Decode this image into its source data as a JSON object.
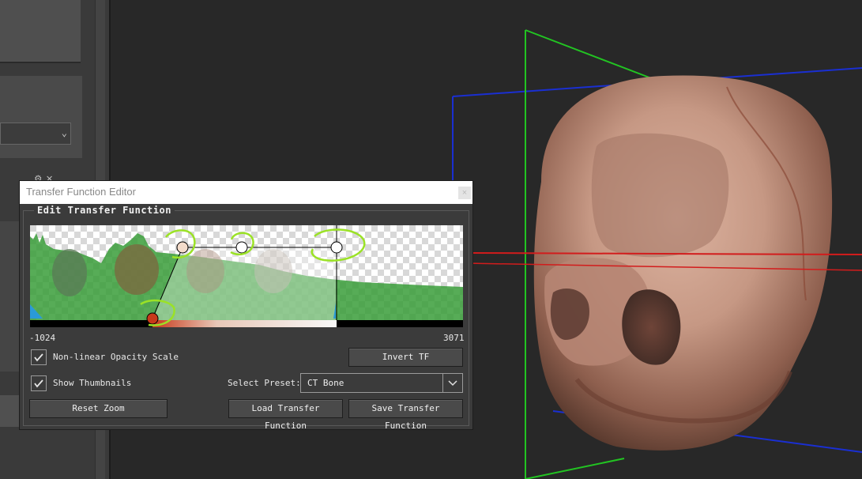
{
  "dialog": {
    "title": "Transfer Function Editor",
    "close_label": "×",
    "group_title": "Edit Transfer Function",
    "range_min": "-1024",
    "range_max": "3071",
    "nonlinear_label": "Non-linear Opacity Scale",
    "nonlinear_checked": true,
    "thumbnails_label": "Show Thumbnails",
    "thumbnails_checked": true,
    "invert_label": "Invert TF",
    "preset_label": "Select Preset:",
    "preset_value": "CT Bone",
    "reset_zoom_label": "Reset Zoom",
    "load_label": "Load Transfer Function",
    "save_label": "Save Transfer Function"
  },
  "icons": {
    "checkbox": "check-icon",
    "dropdown": "chevron-down-icon",
    "close": "close-icon"
  },
  "colors": {
    "histogram": "#3a9e3a",
    "control_point_selected": "#c8391a",
    "annotation": "#9be226",
    "axis_green": "#22c422",
    "axis_red": "#d21c1c",
    "axis_blue": "#1a2fd2"
  }
}
